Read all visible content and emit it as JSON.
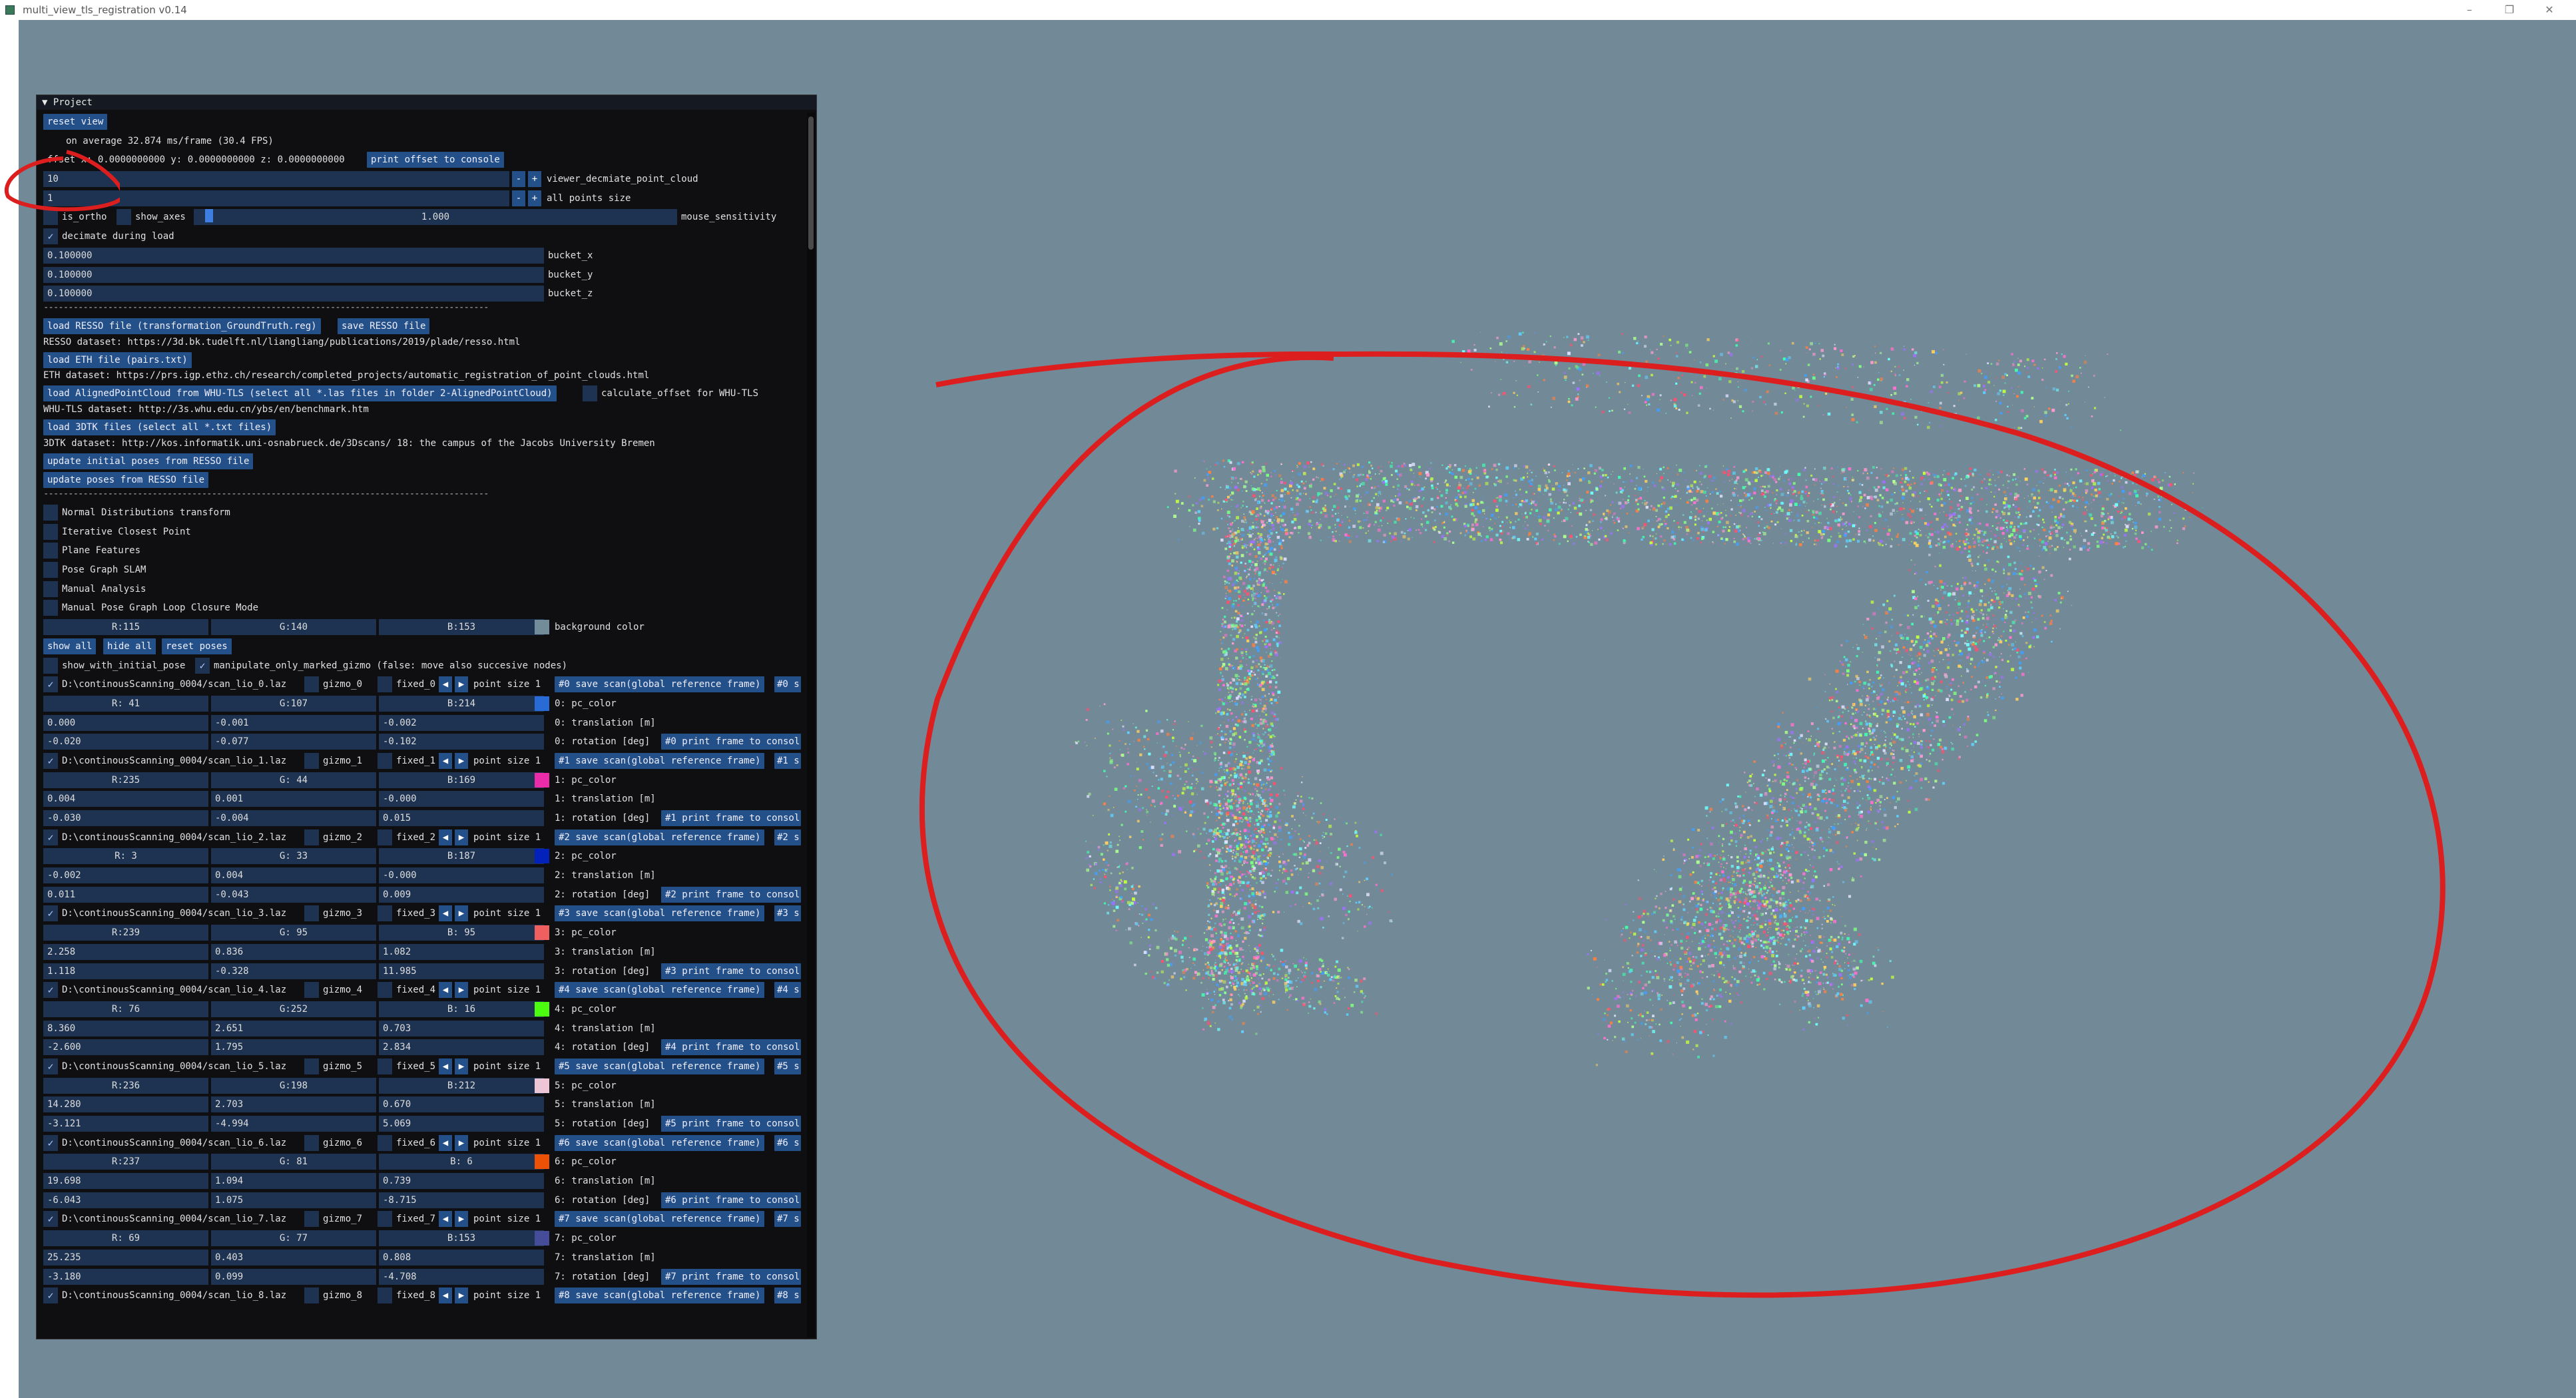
{
  "window": {
    "title": "multi_view_tls_registration v0.14",
    "min": "–",
    "max": "❐",
    "close": "✕"
  },
  "panel": {
    "title": "▼ Project",
    "reset_view": "reset view",
    "fps": "on average 32.874 ms/frame (30.4 FPS)",
    "offset": "ffset x: 0.0000000000 y: 0.0000000000 z: 0.0000000000",
    "print_offset": "print offset to console",
    "decimate_value": "10",
    "decimate_label": "viewer_decmiate_point_cloud",
    "points_size_value": "1",
    "points_size_label": "all points size",
    "is_ortho": "is_ortho",
    "show_axes": "show_axes",
    "mouse_sensitivity_value": "1.000",
    "mouse_sensitivity_fraction": 0.015,
    "mouse_sensitivity_label": "mouse_sensitivity",
    "decimate_during_load": "decimate during load",
    "bucket_x_value": "0.100000",
    "bucket_x": "bucket_x",
    "bucket_y_value": "0.100000",
    "bucket_y": "bucket_y",
    "bucket_z_value": "0.100000",
    "bucket_z": "bucket_z",
    "separator": "------------------------------------------------------------------------------------------",
    "load_resso": "load RESSO file (transformation_GroundTruth.reg)",
    "save_resso": "save RESSO file",
    "resso_dataset": "RESSO dataset: https://3d.bk.tudelft.nl/liangliang/publications/2019/plade/resso.html",
    "load_eth": "load ETH file (pairs.txt)",
    "eth_dataset": "ETH dataset: https://prs.igp.ethz.ch/research/completed_projects/automatic_registration_of_point_clouds.html",
    "load_whu": "load AlignedPointCloud from WHU-TLS (select all *.las files in folder 2-AlignedPointCloud)",
    "calc_offset": "calculate_offset for WHU-TLS",
    "whu_dataset": "WHU-TLS dataset: http://3s.whu.edu.cn/ybs/en/benchmark.htm",
    "load_3dtk": "load 3DTK files (select all *.txt files)",
    "dtk_dataset": "3DTK dataset: http://kos.informatik.uni-osnabrueck.de/3Dscans/ 18: the campus of the Jacobs University Bremen",
    "update_initial": "update initial poses from RESSO file",
    "update_poses": "update poses from RESSO file",
    "methods": [
      "Normal Distributions transform",
      "Iterative Closest Point",
      "Plane Features",
      "Pose Graph SLAM",
      "Manual Analysis",
      "Manual Pose Graph Loop Closure Mode"
    ],
    "bg_r": "R:115",
    "bg_g": "G:140",
    "bg_b": "B:153",
    "bg_color_label": "background color",
    "bg_color": "#738c99",
    "show_all": "show all",
    "hide_all": "hide all",
    "reset_poses": "reset poses",
    "show_with_initial_pose": "show_with_initial_pose",
    "manipulate_only": "manipulate_only_marked_gizmo (false: move also succesive nodes)",
    "check": "✓",
    "arrow_left": "◀",
    "arrow_right": "▶",
    "minus": "-",
    "plus": "+",
    "translation_suffix": "translation [m]",
    "rotation_suffix": "rotation [deg]",
    "pc_color_suffix": "pc_color"
  },
  "scans": [
    {
      "file": "D:\\continousScanning_0004/scan_lio_0.laz",
      "gizmo": "gizmo_0",
      "fixed": "fixed_0",
      "point_size": "point size 1",
      "save": "#0 save scan(global reference frame)",
      "extra": "#0 s",
      "r": "R: 41",
      "g": "G:107",
      "b": "B:214",
      "color": "#296bd6",
      "pc": "0: pc_color",
      "t": [
        "0.000",
        "-0.001",
        "-0.002"
      ],
      "tl": "0: translation [m]",
      "rot": [
        "-0.020",
        "-0.077",
        "-0.102"
      ],
      "rl": "0: rotation [deg]",
      "print": "#0 print frame to consol"
    },
    {
      "file": "D:\\continousScanning_0004/scan_lio_1.laz",
      "gizmo": "gizmo_1",
      "fixed": "fixed_1",
      "point_size": "point size 1",
      "save": "#1 save scan(global reference frame)",
      "extra": "#1 s",
      "r": "R:235",
      "g": "G: 44",
      "b": "B:169",
      "color": "#eb2ca9",
      "pc": "1: pc_color",
      "t": [
        "0.004",
        "0.001",
        "-0.000"
      ],
      "tl": "1: translation [m]",
      "rot": [
        "-0.030",
        "-0.004",
        "0.015"
      ],
      "rl": "1: rotation [deg]",
      "print": "#1 print frame to consol"
    },
    {
      "file": "D:\\continousScanning_0004/scan_lio_2.laz",
      "gizmo": "gizmo_2",
      "fixed": "fixed_2",
      "point_size": "point size 1",
      "save": "#2 save scan(global reference frame)",
      "extra": "#2 s",
      "r": "R:  3",
      "g": "G: 33",
      "b": "B:187",
      "color": "#0321bb",
      "pc": "2: pc_color",
      "t": [
        "-0.002",
        "0.004",
        "-0.000"
      ],
      "tl": "2: translation [m]",
      "rot": [
        "0.011",
        "-0.043",
        "0.009"
      ],
      "rl": "2: rotation [deg]",
      "print": "#2 print frame to consol"
    },
    {
      "file": "D:\\continousScanning_0004/scan_lio_3.laz",
      "gizmo": "gizmo_3",
      "fixed": "fixed_3",
      "point_size": "point size 1",
      "save": "#3 save scan(global reference frame)",
      "extra": "#3 s",
      "r": "R:239",
      "g": "G: 95",
      "b": "B: 95",
      "color": "#ef5f5f",
      "pc": "3: pc_color",
      "t": [
        "2.258",
        "0.836",
        "1.082"
      ],
      "tl": "3: translation [m]",
      "rot": [
        "1.118",
        "-0.328",
        "11.985"
      ],
      "rl": "3: rotation [deg]",
      "print": "#3 print frame to consol"
    },
    {
      "file": "D:\\continousScanning_0004/scan_lio_4.laz",
      "gizmo": "gizmo_4",
      "fixed": "fixed_4",
      "point_size": "point size 1",
      "save": "#4 save scan(global reference frame)",
      "extra": "#4 s",
      "r": "R: 76",
      "g": "G:252",
      "b": "B: 16",
      "color": "#4cfc10",
      "pc": "4: pc_color",
      "t": [
        "8.360",
        "2.651",
        "0.703"
      ],
      "tl": "4: translation [m]",
      "rot": [
        "-2.600",
        "1.795",
        "2.834"
      ],
      "rl": "4: rotation [deg]",
      "print": "#4 print frame to consol"
    },
    {
      "file": "D:\\continousScanning_0004/scan_lio_5.laz",
      "gizmo": "gizmo_5",
      "fixed": "fixed_5",
      "point_size": "point size 1",
      "save": "#5 save scan(global reference frame)",
      "extra": "#5 s",
      "r": "R:236",
      "g": "G:198",
      "b": "B:212",
      "color": "#ecc6d4",
      "pc": "5: pc_color",
      "t": [
        "14.280",
        "2.703",
        "0.670"
      ],
      "tl": "5: translation [m]",
      "rot": [
        "-3.121",
        "-4.994",
        "5.069"
      ],
      "rl": "5: rotation [deg]",
      "print": "#5 print frame to consol"
    },
    {
      "file": "D:\\continousScanning_0004/scan_lio_6.laz",
      "gizmo": "gizmo_6",
      "fixed": "fixed_6",
      "point_size": "point size 1",
      "save": "#6 save scan(global reference frame)",
      "extra": "#6 s",
      "r": "R:237",
      "g": "G: 81",
      "b": "B:  6",
      "color": "#ed5106",
      "pc": "6: pc_color",
      "t": [
        "19.698",
        "1.094",
        "0.739"
      ],
      "tl": "6: translation [m]",
      "rot": [
        "-6.043",
        "1.075",
        "-8.715"
      ],
      "rl": "6: rotation [deg]",
      "print": "#6 print frame to consol"
    },
    {
      "file": "D:\\continousScanning_0004/scan_lio_7.laz",
      "gizmo": "gizmo_7",
      "fixed": "fixed_7",
      "point_size": "point size 1",
      "save": "#7 save scan(global reference frame)",
      "extra": "#7 s",
      "r": "R: 69",
      "g": "G: 77",
      "b": "B:153",
      "color": "#454d99",
      "pc": "7: pc_color",
      "t": [
        "25.235",
        "0.403",
        "0.808"
      ],
      "tl": "7: translation [m]",
      "rot": [
        "-3.180",
        "0.099",
        "-4.708"
      ],
      "rl": "7: rotation [deg]",
      "print": "#7 print frame to consol"
    },
    {
      "file": "D:\\continousScanning_0004/scan_lio_8.laz",
      "gizmo": "gizmo_8",
      "fixed": "fixed_8",
      "point_size": "point size 1",
      "save": "#8 save scan(global reference frame)",
      "extra": "#8 s"
    }
  ]
}
